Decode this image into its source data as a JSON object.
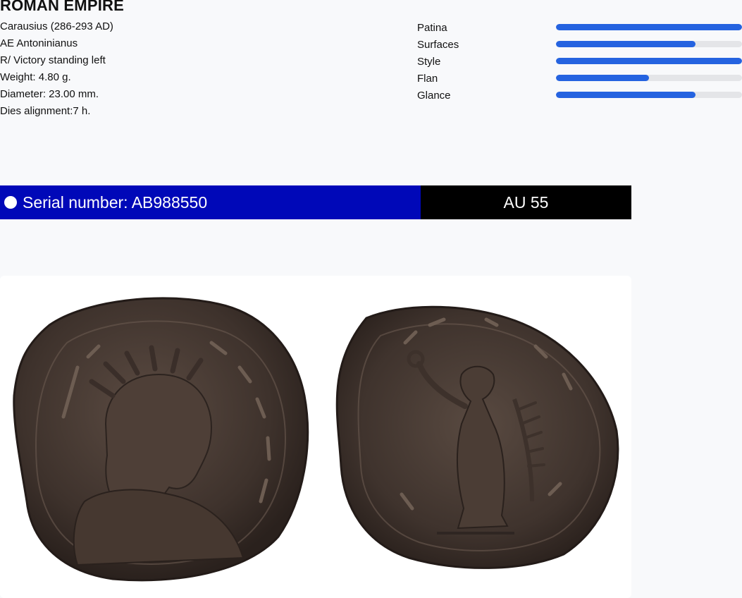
{
  "title": "ROMAN EMPIRE",
  "specs": [
    "Carausius (286-293 AD)",
    "AE Antoninianus",
    "R/ Victory standing left",
    "Weight: 4.80 g.",
    "Diameter: 23.00 mm.",
    "Dies alignment:7 h."
  ],
  "grades": [
    {
      "label": "Patina",
      "level": 1.0
    },
    {
      "label": "Surfaces",
      "level": 0.75
    },
    {
      "label": "Style",
      "level": 1.0
    },
    {
      "label": "Flan",
      "level": 0.5
    },
    {
      "label": "Glance",
      "level": 0.75
    }
  ],
  "serial": {
    "text": "Serial number: AB988550",
    "grade": "AU 55"
  },
  "colors": {
    "serial_bg": "#0008b8",
    "grade_bg": "#000000",
    "bar_fill": "#2563e0",
    "bar_track": "#e4e5e8",
    "coin_dark": "#3a2e28",
    "coin_mid": "#5a4a40"
  }
}
